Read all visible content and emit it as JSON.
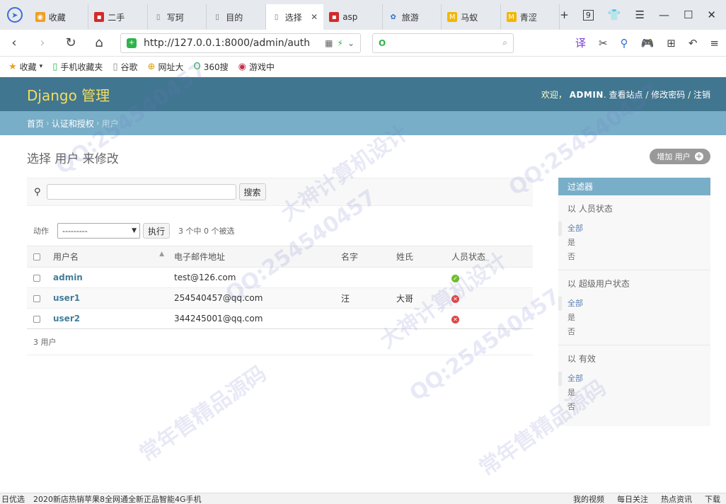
{
  "browser": {
    "tabs": [
      {
        "label": "收藏",
        "icon": "browser-home-icon",
        "fav_color": "#f0a020"
      },
      {
        "label": "二手",
        "icon": "red-square-icon",
        "fav_color": "#d12b2b"
      },
      {
        "label": "写珂",
        "icon": "document-icon",
        "fav_color": "#999999"
      },
      {
        "label": "目的",
        "icon": "document-icon",
        "fav_color": "#999999"
      },
      {
        "label": "选择",
        "icon": "document-icon",
        "fav_color": "#999999",
        "active": true
      },
      {
        "label": "asp",
        "icon": "red-square-icon",
        "fav_color": "#d12b2b"
      },
      {
        "label": "旅游",
        "icon": "paw-icon",
        "fav_color": "#2d6fd0"
      },
      {
        "label": "马蚁",
        "icon": "mail-icon",
        "fav_color": "#f2b705"
      },
      {
        "label": "青涩",
        "icon": "mail-icon",
        "fav_color": "#f2b705"
      }
    ],
    "url": "http://127.0.0.1:8000/admin/auth",
    "window_badge": "9",
    "bookmarks": [
      "收藏",
      "手机收藏夹",
      "谷歌",
      "网址大",
      "360搜",
      "游戏中"
    ]
  },
  "admin": {
    "brand": "Django 管理",
    "welcome": "欢迎，",
    "username": "ADMIN",
    "sep": ".",
    "view_site": "查看站点",
    "slash": "/",
    "change_password": "修改密码",
    "logout": "注销",
    "breadcrumbs": {
      "home": "首页",
      "app": "认证和授权",
      "current": "用户",
      "sep": "›"
    },
    "title": "选择 用户 来修改",
    "add_button": "增加 用户",
    "search_button": "搜索",
    "actions_label": "动作",
    "actions_select": "---------",
    "go_button": "执行",
    "selection_counter": "3 个中 0 个被选",
    "columns": {
      "username": "用户名",
      "email": "电子邮件地址",
      "first_name": "名字",
      "last_name": "姓氏",
      "staff": "人员状态"
    },
    "rows": [
      {
        "username": "admin",
        "email": "test@126.com",
        "first_name": "",
        "last_name": "",
        "staff": true
      },
      {
        "username": "user1",
        "email": "254540457@qq.com",
        "first_name": "汪",
        "last_name": "大哥",
        "staff": false
      },
      {
        "username": "user2",
        "email": "344245001@qq.com",
        "first_name": "",
        "last_name": "",
        "staff": false
      }
    ],
    "paginator": "3 用户",
    "filter": {
      "title": "过滤器",
      "sections": [
        {
          "title": "以 人员状态",
          "options": [
            "全部",
            "是",
            "否"
          ]
        },
        {
          "title": "以 超级用户状态",
          "options": [
            "全部",
            "是",
            "否"
          ]
        },
        {
          "title": "以 有效",
          "options": [
            "全部",
            "是",
            "否"
          ]
        }
      ]
    }
  },
  "statusbar": {
    "left": "日优选",
    "news": "2020新店热销苹果8全网通全新正品智能4G手机",
    "items": [
      "我的视频",
      "每日关注",
      "热点资讯"
    ],
    "download": "下载"
  },
  "watermark": [
    "QQ:254540457",
    "大神计算机设计",
    "常年售精品源码"
  ],
  "colors": {
    "header": "#417690",
    "breadcrumbs": "#79aec8",
    "brand": "#f5dd5d",
    "link": "#447e9b",
    "ok": "#70bf2b",
    "no": "#dd4646"
  }
}
